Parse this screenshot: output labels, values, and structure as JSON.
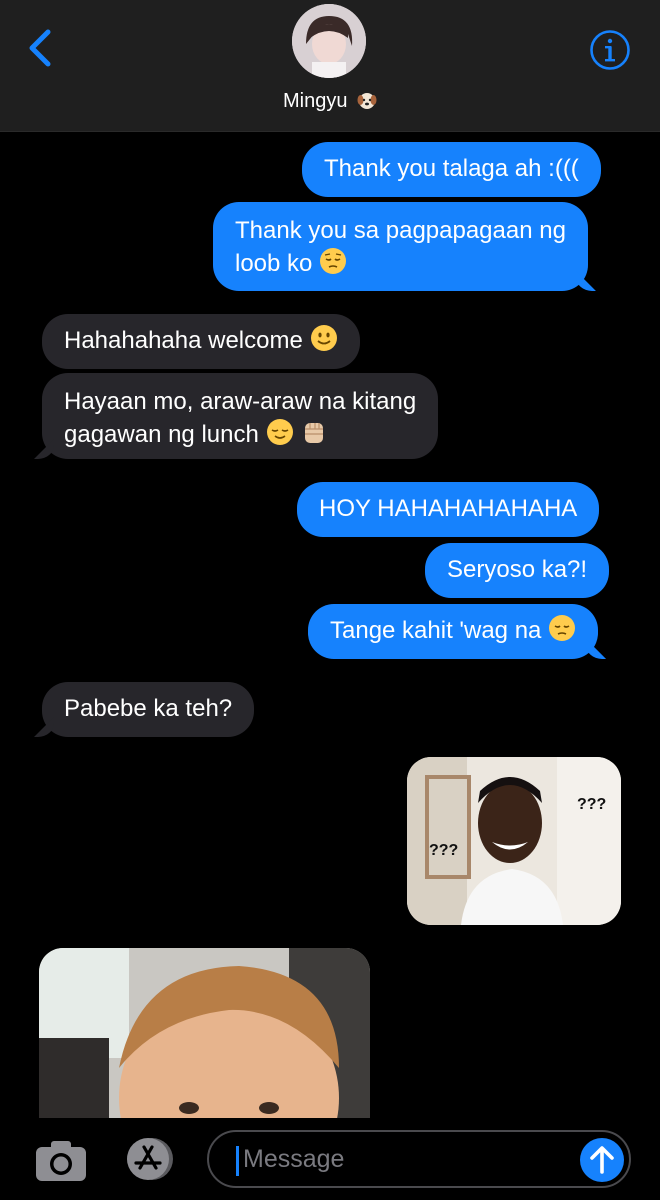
{
  "header": {
    "contact_name": "Mingyu",
    "contact_emoji": "dog-face-emoji",
    "back_icon": "chevron-left-icon",
    "info_icon": "info-icon"
  },
  "messages": [
    {
      "direction": "sent",
      "text": "Thank you talaga ah :((("
    },
    {
      "direction": "sent",
      "text_line1": "Thank you sa pagpapagaan ng",
      "text_line2": "loob ko",
      "emoji": "pensive-face"
    },
    {
      "direction": "received",
      "text": "Hahahahaha welcome",
      "emoji": "slightly-smiling-face"
    },
    {
      "direction": "received",
      "text_line1": "Hayaan mo, araw-araw na kitang",
      "text_line2": "gagawan ng lunch",
      "emoji": [
        "relieved-face",
        "raised-fist"
      ]
    },
    {
      "direction": "sent",
      "text": "HOY HAHAHAHAHAHA"
    },
    {
      "direction": "sent",
      "text": "Seryoso ka?!"
    },
    {
      "direction": "sent",
      "text": "Tange kahit 'wag na",
      "emoji": "pensive-face"
    },
    {
      "direction": "received",
      "text": "Pabebe ka teh?"
    },
    {
      "direction": "sent",
      "type": "image",
      "meme_text_1": "???",
      "meme_text_2": "???"
    },
    {
      "direction": "received",
      "type": "image"
    }
  ],
  "compose": {
    "placeholder": "Message",
    "camera_icon": "camera-icon",
    "apps_icon": "app-store-icon",
    "send_icon": "send-arrow-icon"
  },
  "colors": {
    "sent_bubble": "#1682fd",
    "received_bubble": "#27262b",
    "background": "#000000",
    "header": "#1f1f1f"
  }
}
